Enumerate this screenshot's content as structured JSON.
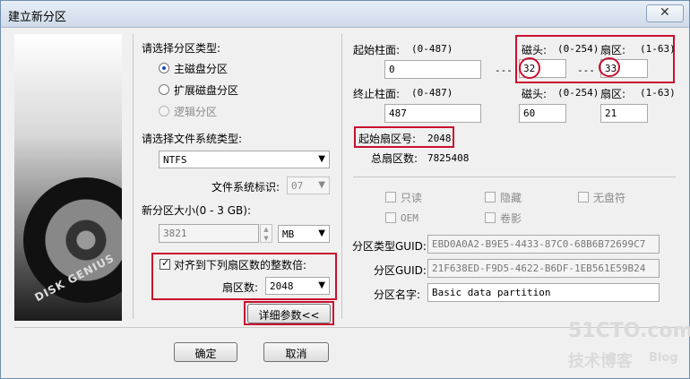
{
  "window": {
    "title": "建立新分区",
    "close_glyph": "✕"
  },
  "left": {
    "partition_type_label": "请选择分区类型:",
    "partition_types": [
      "主磁盘分区",
      "扩展磁盘分区",
      "逻辑分区"
    ],
    "fs_type_label": "请选择文件系统类型:",
    "fs_type_value": "NTFS",
    "fs_id_label": "文件系统标识:",
    "fs_id_value": "07",
    "size_label": "新分区大小(0 - 3 GB):",
    "size_value": "3821",
    "size_unit": "MB",
    "align_label": "对齐到下列扇区数的整数倍:",
    "sectors_label": "扇区数:",
    "sectors_value": "2048",
    "details_button": "详细参数<<"
  },
  "right": {
    "start_cyl_label": "起始柱面:",
    "start_cyl_range": "(0-487)",
    "start_cyl_value": "0",
    "head_label": "磁头:",
    "head_range": "(0-254)",
    "start_head_value": "32",
    "sector_label": "扇区:",
    "sector_range": "(1-63)",
    "start_sector_value": "33",
    "end_cyl_label": "终止柱面:",
    "end_cyl_range": "(0-487)",
    "end_cyl_value": "487",
    "end_head_label": "磁头:",
    "end_head_range": "(0-254)",
    "end_head_value": "60",
    "end_sector_label": "扇区:",
    "end_sector_range": "(1-63)",
    "end_sector_value": "21",
    "dash": "---",
    "start_sector_no_label": "起始扇区号:",
    "start_sector_no_value": "2048",
    "total_sectors_label": "总扇区数:",
    "total_sectors_value": "7825408",
    "flags": [
      "只读",
      "隐藏",
      "无盘符",
      "OEM",
      "卷影"
    ],
    "type_guid_label": "分区类型GUID:",
    "type_guid_value": "EBD0A0A2-B9E5-4433-87C0-68B6B72699C7",
    "part_guid_label": "分区GUID:",
    "part_guid_value": "21F638ED-F9D5-4622-B6DF-1EB561E59B24",
    "part_name_label": "分区名字:",
    "part_name_value": "Basic data partition"
  },
  "buttons": {
    "ok": "确定",
    "cancel": "取消"
  },
  "watermark": {
    "line1": "51CTO.com",
    "line2": "技术博客",
    "line3": "Blog"
  },
  "logo_text": "DISK GENIUS",
  "colors": {
    "highlight": "#c8102e",
    "titlebar": "#dce6f2"
  }
}
